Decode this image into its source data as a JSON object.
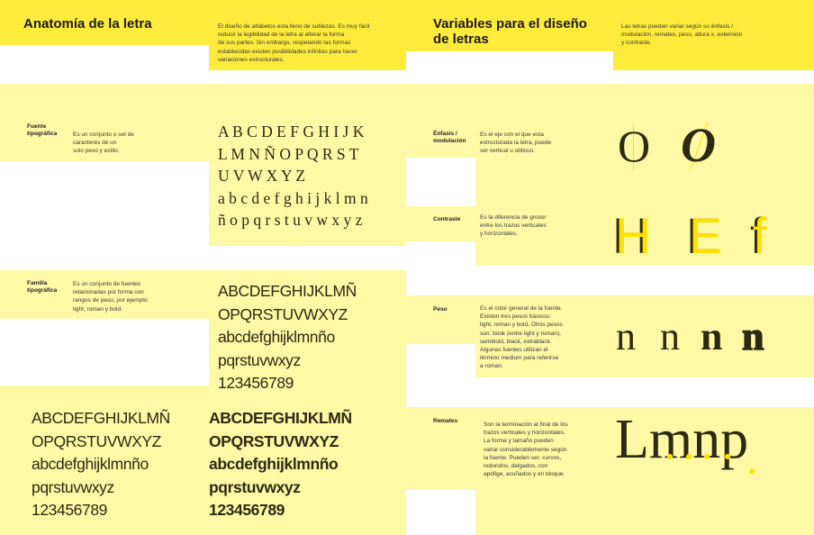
{
  "left": {
    "title": "Anatomía de la letra",
    "intro": "El diseño de alfabetos esta lleno de sutilezas. Es muy fácil\nreducir la legibilidad de la letra al alterar la forma\nde sus partes. Sin embargo, respetando las formas\nestablecidas existen posibilidades infinitas para hacer\nvariaciones estructurales.",
    "fuente_label": "Fuente\ntipográfica",
    "fuente_desc": "Es un conjunto o set de\ncaracteres de un\nsolo peso y estilo.",
    "serif_sample": "A B C D E F G H I J K\nL M N Ñ O P Q R S T\nU V W X Y Z\na b c d e f g h i j k l m n\nñ o p q r s t u v w x y z",
    "familia_label": "Familia\ntipográfica",
    "familia_desc": "Es un conjunto de fuentes\nrelacionadas por forma con\nrangos de peso, por ejemplo:\nlight, roman y bold.",
    "sans_light_sample": "ABCDEFGHIJKLMÑ\nOPQRSTUVWXYZ\nabcdefghijklmnño\npqrstuvwxyz\n123456789",
    "sans_regular_sample": "ABCDEFGHIJKLMÑ\nOPQRSTUVWXYZ\nabcdefghijklmnño\npqrstuvwxyz\n123456789",
    "sans_bold_sample": "ABCDEFGHIJKLMÑ\nOPQRSTUVWXYZ\nabcdefghijklmnño\npqrstuvwxyz\n123456789"
  },
  "right": {
    "title": "Variables para el diseño\nde letras",
    "intro": "Las letras pueden variar según su énfasis /\nmodulación, remates, peso, altura x, extensión\ny contraste.",
    "enfasis_label": "Énfasis /\nmodulación",
    "enfasis_desc": "Es el eje con el que esta\nestructurada la letra, puede\nser vertical u oblicuo.",
    "enfasis_glyphs": [
      "O",
      "O"
    ],
    "contraste_label": "Contraste",
    "contraste_desc": "Es la diferencia de grosor\nentre los trazos verticales\ny horizontales.",
    "contraste_glyphs": [
      "H",
      "E",
      "f"
    ],
    "peso_label": "Peso",
    "peso_desc": "Es el color general de la fuente.\nExisten tres pesos básicos:\nlight, roman y bold. Otros pesos\nson: book (entre light y roman),\nsemibold, black, extrablack.\nAlgunas fuentes utilizan el\ntérmino medium para referirse\na roman.",
    "peso_glyphs": [
      "n",
      "n",
      "n",
      "n"
    ],
    "remates_label": "Remates",
    "remates_desc": "Son la terminación al final de los\ntrazos verticales y horizontales.\nLa forma y tamaño pueden\nvariar considerablemente según\nla fuente. Pueden ser: curvos,\nredondos, delgados, con\napófige, acuñados y en bloque.",
    "remates_word": "Lmnp"
  },
  "colors": {
    "yellow": "#ffeb3b",
    "pale": "#fff9a6",
    "ink": "#2c2a12"
  }
}
